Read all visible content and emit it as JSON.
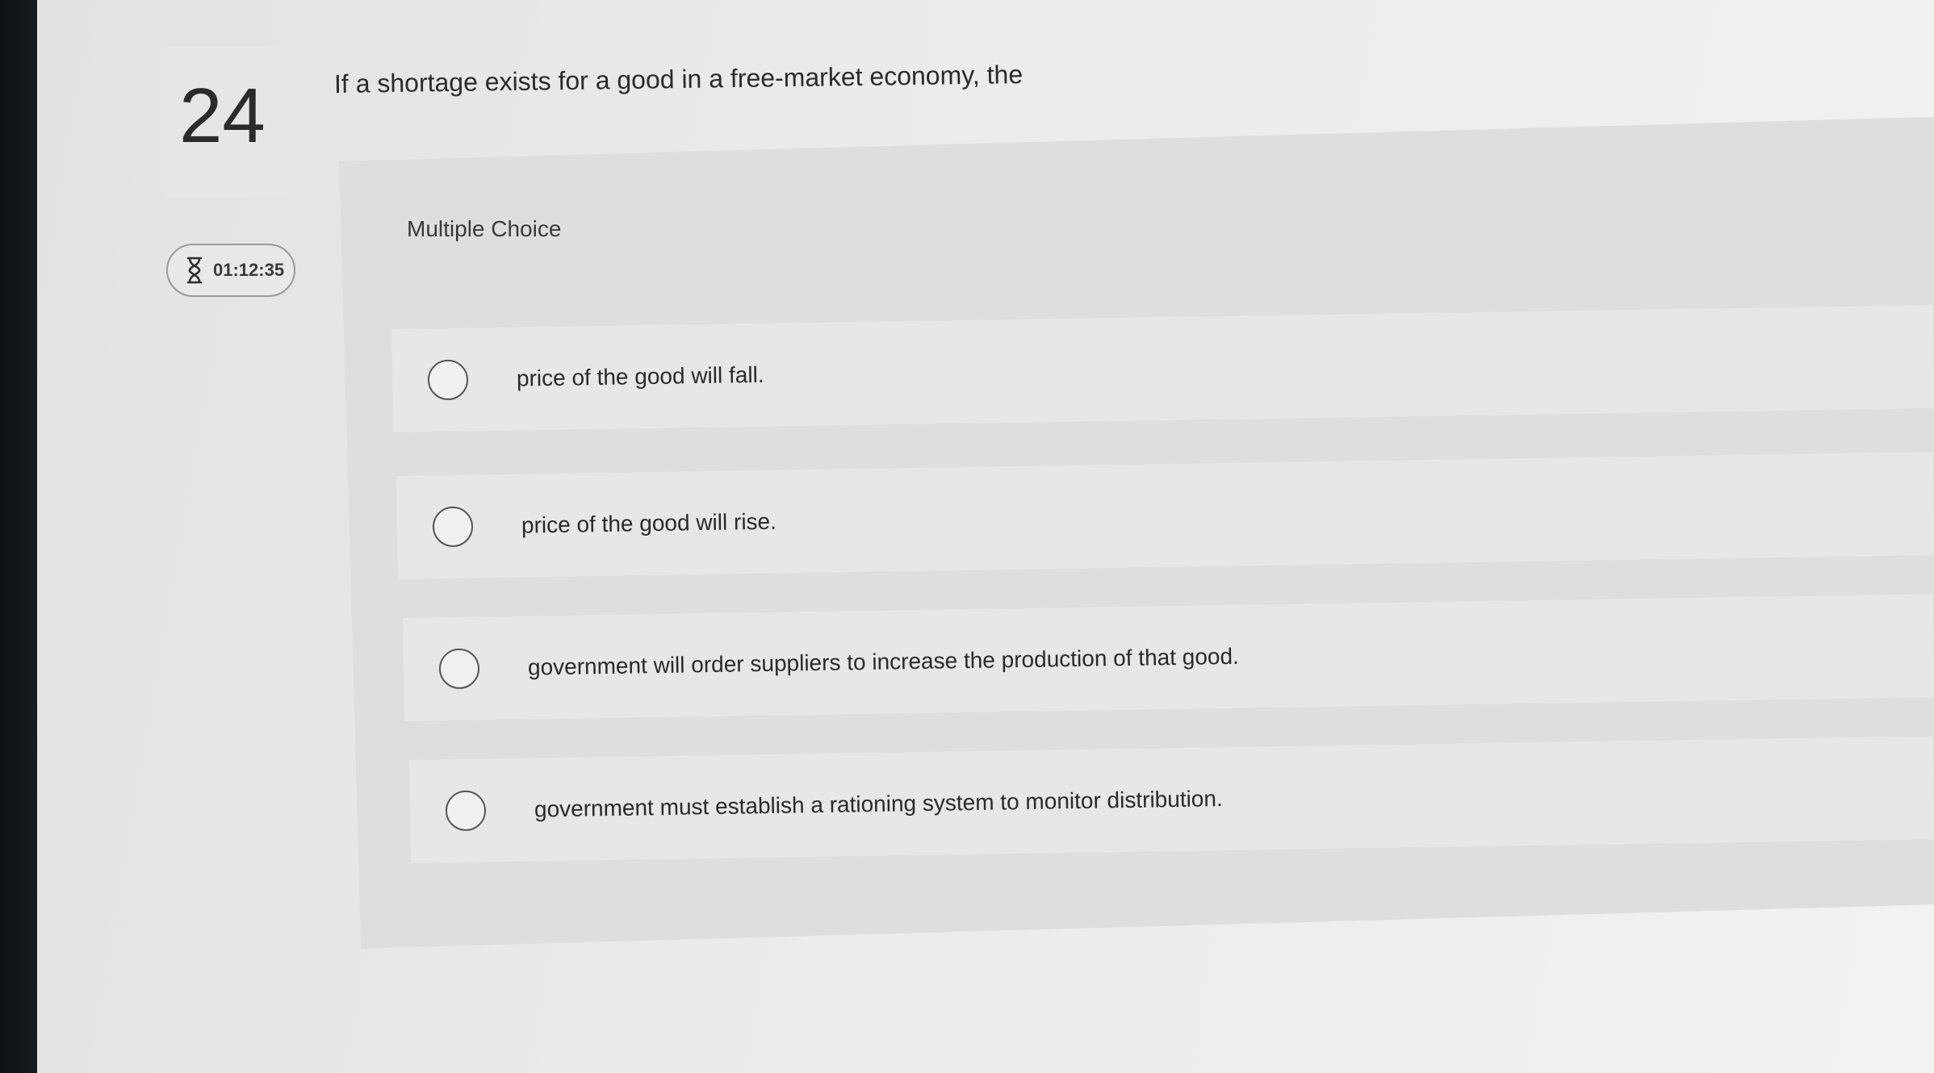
{
  "question": {
    "number": "24",
    "timer": "01:12:35",
    "text": "If a shortage exists for a good in a free-market economy, the",
    "type_label": "Multiple Choice"
  },
  "options": [
    {
      "label": "price of the good will fall.",
      "selected": false
    },
    {
      "label": "price of the good will rise.",
      "selected": false
    },
    {
      "label": "government will order suppliers to increase the production of that good.",
      "selected": false
    },
    {
      "label": "government must establish a rationing system to monitor distribution.",
      "selected": false
    }
  ],
  "icons": {
    "timer": "hourglass-icon",
    "option": "radio-button-icon"
  }
}
